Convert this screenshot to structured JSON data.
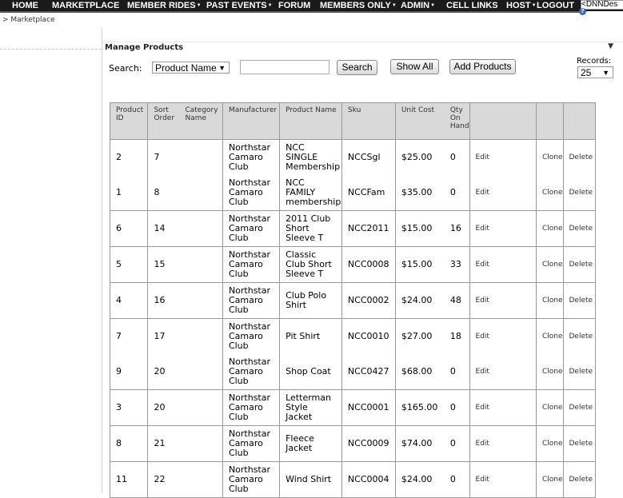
{
  "nav": {
    "items": [
      {
        "label": "HOME",
        "dropdown": false
      },
      {
        "label": "MARKETPLACE",
        "dropdown": false
      },
      {
        "label": "MEMBER RIDES",
        "dropdown": true
      },
      {
        "label": "PAST EVENTS",
        "dropdown": true
      },
      {
        "label": "FORUM",
        "dropdown": false
      },
      {
        "label": "MEMBERS ONLY",
        "dropdown": true
      },
      {
        "label": "ADMIN",
        "dropdown": true
      },
      {
        "label": "CELL LINKS",
        "dropdown": false
      },
      {
        "label": "HOST",
        "dropdown": true
      },
      {
        "label": "LOGOUT",
        "dropdown": false
      }
    ],
    "skin_selector": "<DNNDes"
  },
  "breadcrumb": "> Marketplace",
  "module": {
    "title": "Manage Products"
  },
  "search": {
    "label": "Search:",
    "field_select": "Product Name",
    "text_value": "",
    "search_button": "Search",
    "show_all_button": "Show All",
    "add_button": "Add Products",
    "records_label": "Records:",
    "records_value": "25"
  },
  "table": {
    "headers": {
      "product_id": [
        "Product",
        "ID"
      ],
      "sort_order": [
        "Sort",
        "Order"
      ],
      "category_name": [
        "Category",
        "Name"
      ],
      "manufacturer": [
        "Manufacturer"
      ],
      "product_name": [
        "Product Name"
      ],
      "sku": [
        "Sku"
      ],
      "unit_cost": [
        "Unit Cost"
      ],
      "qty_on_hand": [
        "Qty",
        "On",
        "Hand"
      ]
    },
    "actions": {
      "edit": "Edit",
      "clone": "Clone",
      "delete": "Delete"
    },
    "rows": [
      {
        "id": "2",
        "sort": "7",
        "category": "",
        "manufacturer": [
          "Northstar",
          "Camaro",
          "Club"
        ],
        "name": [
          "NCC",
          "SINGLE",
          "Membership"
        ],
        "sku": "NCCSgl",
        "cost": "$25.00",
        "qty": "0"
      },
      {
        "id": "1",
        "sort": "8",
        "category": "",
        "manufacturer": [
          "Northstar",
          "Camaro",
          "Club"
        ],
        "name": [
          "NCC",
          "FAMILY",
          "membership"
        ],
        "sku": "NCCFam",
        "cost": "$35.00",
        "qty": "0"
      },
      {
        "id": "6",
        "sort": "14",
        "category": "",
        "manufacturer": [
          "Northstar",
          "Camaro",
          "Club"
        ],
        "name": [
          "2011 Club",
          "Short",
          "Sleeve T"
        ],
        "sku": "NCC2011",
        "cost": "$15.00",
        "qty": "16"
      },
      {
        "id": "5",
        "sort": "15",
        "category": "",
        "manufacturer": [
          "Northstar",
          "Camaro",
          "Club"
        ],
        "name": [
          "Classic",
          "Club Short",
          "Sleeve T"
        ],
        "sku": "NCC0008",
        "cost": "$15.00",
        "qty": "33"
      },
      {
        "id": "4",
        "sort": "16",
        "category": "",
        "manufacturer": [
          "Northstar",
          "Camaro",
          "Club"
        ],
        "name": [
          "Club Polo",
          "Shirt"
        ],
        "sku": "NCC0002",
        "cost": "$24.00",
        "qty": "48"
      },
      {
        "id": "7",
        "sort": "17",
        "category": "",
        "manufacturer": [
          "Northstar",
          "Camaro",
          "Club"
        ],
        "name": [
          "Pit Shirt"
        ],
        "sku": "NCC0010",
        "cost": "$27.00",
        "qty": "18"
      },
      {
        "id": "9",
        "sort": "20",
        "category": "",
        "manufacturer": [
          "Northstar",
          "Camaro",
          "Club"
        ],
        "name": [
          "Shop Coat"
        ],
        "sku": "NCC0427",
        "cost": "$68.00",
        "qty": "0"
      },
      {
        "id": "3",
        "sort": "20",
        "category": "",
        "manufacturer": [
          "Northstar",
          "Camaro",
          "Club"
        ],
        "name": [
          "Letterman",
          "Style",
          "Jacket"
        ],
        "sku": "NCC0001",
        "cost": "$165.00",
        "qty": "0"
      },
      {
        "id": "8",
        "sort": "21",
        "category": "",
        "manufacturer": [
          "Northstar",
          "Camaro",
          "Club"
        ],
        "name": [
          "Fleece",
          "Jacket"
        ],
        "sku": "NCC0009",
        "cost": "$74.00",
        "qty": "0"
      },
      {
        "id": "11",
        "sort": "22",
        "category": "",
        "manufacturer": [
          "Northstar",
          "Camaro",
          "Club"
        ],
        "name": [
          "Wind Shirt"
        ],
        "sku": "NCC0004",
        "cost": "$24.00",
        "qty": "0"
      }
    ]
  }
}
